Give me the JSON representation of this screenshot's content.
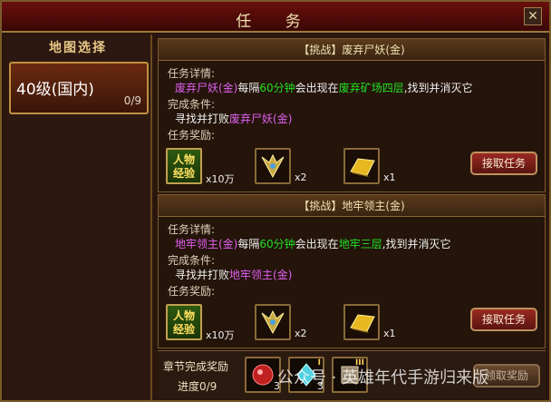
{
  "window": {
    "title": "任 务",
    "close_glyph": "✕"
  },
  "sidebar": {
    "header": "地图选择",
    "items": [
      {
        "label": "40级(国内)",
        "count": "0/9"
      }
    ]
  },
  "labels": {
    "details": "任务详情:",
    "conditions": "完成条件:",
    "rewards": "任务奖励:",
    "accept": "接取任务",
    "exp_line1": "人物",
    "exp_line2": "经验"
  },
  "tasks": [
    {
      "title": "【挑战】废弃尸妖(金)",
      "detail_monster": "废弃尸妖(金)",
      "detail_mid": "每隔",
      "detail_interval": "60分钟",
      "detail_mid2": "会出现在",
      "detail_place": "废弃矿场四层",
      "detail_end": ",找到并消灭它",
      "cond_prefix": "寻找并打败",
      "cond_monster": "废弃尸妖(金)",
      "rewards": [
        "x10万",
        "x2",
        "x1"
      ]
    },
    {
      "title": "【挑战】地牢领主(金)",
      "detail_monster": "地牢领主(金)",
      "detail_mid": "每隔",
      "detail_interval": "60分钟",
      "detail_mid2": "会出现在",
      "detail_place": "地牢三层",
      "detail_end": ",找到并消灭它",
      "cond_prefix": "寻找并打败",
      "cond_monster": "地牢领主(金)",
      "rewards": [
        "x10万",
        "x2",
        "x1"
      ]
    }
  ],
  "chapter": {
    "title": "章节完成奖励",
    "progress": "进度0/9",
    "items": [
      {
        "icon": "red-gem-icon",
        "qty": "3",
        "tier": ""
      },
      {
        "icon": "crystal-icon",
        "qty": "3",
        "tier": "I"
      },
      {
        "icon": "scroll-icon",
        "qty": "",
        "tier": "III"
      }
    ],
    "claim": "领取奖励"
  },
  "watermark": "公众号 · 英雄年代手游归来版",
  "colors": {
    "monster": "#e060f0",
    "highlight": "#22e022",
    "gold": "#c09040"
  }
}
